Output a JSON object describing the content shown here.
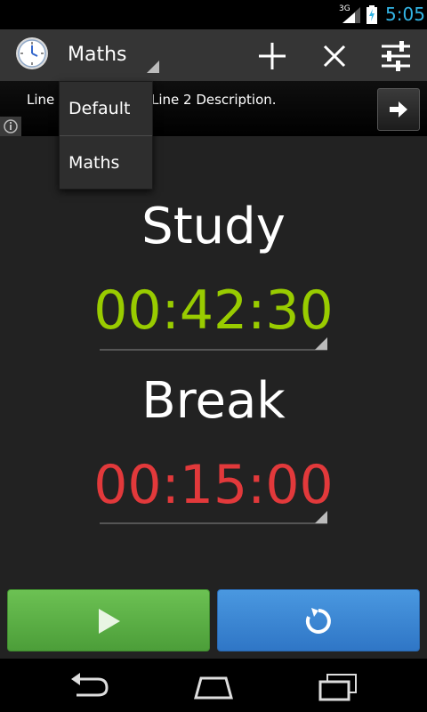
{
  "status_bar": {
    "network": "3G",
    "time": "5:05",
    "clock_color": "#33b5e5"
  },
  "action_bar": {
    "app_icon": "clock-icon",
    "spinner_selected": "Maths",
    "actions": [
      {
        "icon": "plus-icon"
      },
      {
        "icon": "close-icon"
      },
      {
        "icon": "sliders-icon"
      }
    ]
  },
  "ad": {
    "line1": "Line",
    "line2": "Line 2 Description.",
    "arrow_icon": "arrow-right-icon",
    "info_icon": "info-icon"
  },
  "dropdown": {
    "options": [
      "Default",
      "Maths"
    ]
  },
  "study": {
    "label": "Study",
    "time": "00:42:30",
    "color": "#99cc00"
  },
  "break": {
    "label": "Break",
    "time": "00:15:00",
    "color": "#e2393b"
  },
  "controls": {
    "play_icon": "play-icon",
    "reset_icon": "refresh-icon"
  },
  "nav": {
    "back_icon": "back-icon",
    "home_icon": "home-icon",
    "recents_icon": "recents-icon"
  }
}
